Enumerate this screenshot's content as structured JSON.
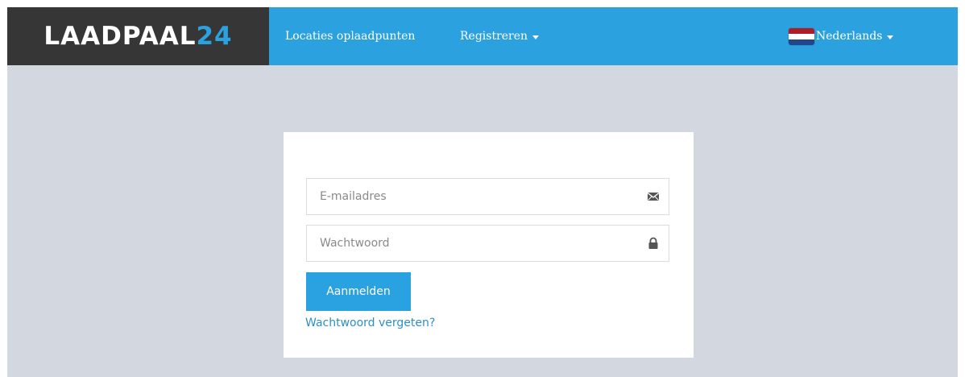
{
  "navbar": {
    "brand_text": "LAADPAAL",
    "brand_accent": "24",
    "links": [
      {
        "label": "Locaties oplaadpunten"
      },
      {
        "label": "Registreren"
      }
    ],
    "language": {
      "label": "Nederlands",
      "flag_icon": "netherlands-flag-icon"
    }
  },
  "login": {
    "email": {
      "value": "",
      "placeholder": "E-mailadres",
      "icon": "envelope-icon"
    },
    "password": {
      "value": "",
      "placeholder": "Wachtwoord",
      "icon": "lock-icon"
    },
    "submit_label": "Aanmelden",
    "forgot_label": "Wachtwoord vergeten?"
  },
  "colors": {
    "navbar_blue": "#2ba1e0",
    "brand_dark": "#363636",
    "page_background": "#d3d7df",
    "button_blue": "#2aa1e0",
    "link_blue": "#2a8fc9"
  }
}
